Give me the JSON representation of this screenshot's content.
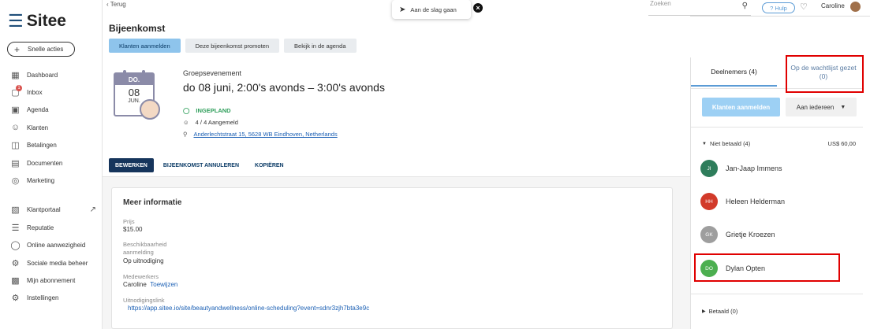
{
  "brand": {
    "name": "Sitee"
  },
  "sidebar": {
    "quick_actions": "Snelle acties",
    "items": [
      {
        "label": "Dashboard",
        "icon": "dashboard-icon"
      },
      {
        "label": "Inbox",
        "icon": "inbox-icon",
        "badge": "1"
      },
      {
        "label": "Agenda",
        "icon": "calendar-icon"
      },
      {
        "label": "Klanten",
        "icon": "users-icon"
      },
      {
        "label": "Betalingen",
        "icon": "payments-icon"
      },
      {
        "label": "Documenten",
        "icon": "document-icon"
      },
      {
        "label": "Marketing",
        "icon": "target-icon"
      }
    ],
    "items2": [
      {
        "label": "Klantportaal",
        "icon": "portal-icon"
      },
      {
        "label": "Reputatie",
        "icon": "reputation-icon"
      },
      {
        "label": "Online aanwezigheid",
        "icon": "globe-icon"
      },
      {
        "label": "Sociale media beheer",
        "icon": "social-icon"
      },
      {
        "label": "Mijn abonnement",
        "icon": "clipboard-icon"
      },
      {
        "label": "Instellingen",
        "icon": "settings-icon"
      }
    ]
  },
  "topbar": {
    "back": "‹ Terug",
    "toast": "Aan de slag gaan",
    "search_placeholder": "Zoeken",
    "help": "? Hulp",
    "user": "Caroline"
  },
  "page": {
    "title": "Bijeenkomst",
    "tabs": [
      "Klanten aanmelden",
      "Deze bijeenkomst promoten",
      "Bekijk in de agenda"
    ]
  },
  "event": {
    "cal_weekday": "DO.",
    "cal_day": "08",
    "cal_month": "JUN.",
    "type": "Groepsevenement",
    "datetime": "do 08 juni, 2:00's avonds – 3:00's avonds",
    "status": "INGEPLAND",
    "registered": "4 / 4 Aangemeld",
    "location": "Anderlechtstraat 15, 5628 WB Eindhoven, Netherlands"
  },
  "actions": {
    "edit": "BEWERKEN",
    "cancel": "BIJEENKOMST ANNULEREN",
    "copy": "KOPIËREN"
  },
  "info": {
    "heading": "Meer informatie",
    "price_label": "Prijs",
    "price": "$15.00",
    "availability_label1": "Beschikbaarheid",
    "availability_label2": "aanmelding",
    "availability": "Op uitnodiging",
    "staff_label": "Medewerkers",
    "staff": "Caroline",
    "assign": "Toewijzen",
    "invite_label": "Uitnodigingslink",
    "invite_link": "https://app.sitee.io/site/beautyandwellness/online-scheduling?event=sdnr3zjh7bta3e9c"
  },
  "panel": {
    "tab_participants": "Deelnemers (4)",
    "tab_waitlist": "Op de wachtlijst gezet (0)",
    "register_btn": "Klanten aanmelden",
    "to_all": "Aan iedereen",
    "unpaid": "Niet betaald (4)",
    "unpaid_amount": "US$ 60,00",
    "paid": "Betaald (0)",
    "attendees": [
      {
        "initials": "JI",
        "name": "Jan-Jaap Immens",
        "color": "#2e7d5b"
      },
      {
        "initials": "HH",
        "name": "Heleen Helderman",
        "color": "#d23a2a"
      },
      {
        "initials": "GK",
        "name": "Grietje Kroezen",
        "color": "#9e9e9e"
      },
      {
        "initials": "DO",
        "name": "Dylan Opten",
        "color": "#4caf50"
      }
    ]
  }
}
